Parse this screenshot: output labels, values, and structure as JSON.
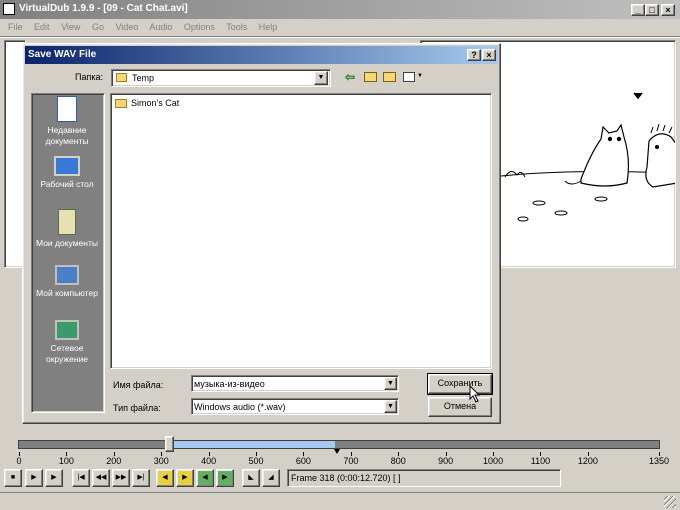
{
  "main_window": {
    "title": "VirtualDub 1.9.9 - [09 - Cat Chat.avi]",
    "menu": [
      "File",
      "Edit",
      "View",
      "Go",
      "Video",
      "Audio",
      "Options",
      "Tools",
      "Help"
    ]
  },
  "dialog": {
    "title": "Save WAV File",
    "help_button": "?",
    "close_button": "×",
    "folder_label": "Папка:",
    "folder_value": "Temp",
    "places": [
      "Недавние документы",
      "Рабочий стол",
      "Мои документы",
      "Мой компьютер",
      "Сетевое окружение"
    ],
    "files": [
      "Simon's Cat"
    ],
    "filename_label": "Имя файла:",
    "filename_value": "музыка-из-видео",
    "filetype_label": "Тип файла:",
    "filetype_value": "Windows audio (*.wav)",
    "save_button": "Сохранить",
    "cancel_button": "Отмена"
  },
  "timeline": {
    "ticks": [
      "0",
      "100",
      "200",
      "300",
      "400",
      "500",
      "600",
      "700",
      "800",
      "900",
      "1000",
      "1100",
      "1200",
      "1350"
    ],
    "selection_start": 320,
    "selection_end": 670,
    "total_frames": 1350
  },
  "status": {
    "frame_text": "Frame 318 (0:00:12.720) [ ]"
  },
  "colors": {
    "titlebar": "#0a246a",
    "places_bar": "#808080",
    "selection": "#a6caf0",
    "face": "#d4d0c8"
  }
}
